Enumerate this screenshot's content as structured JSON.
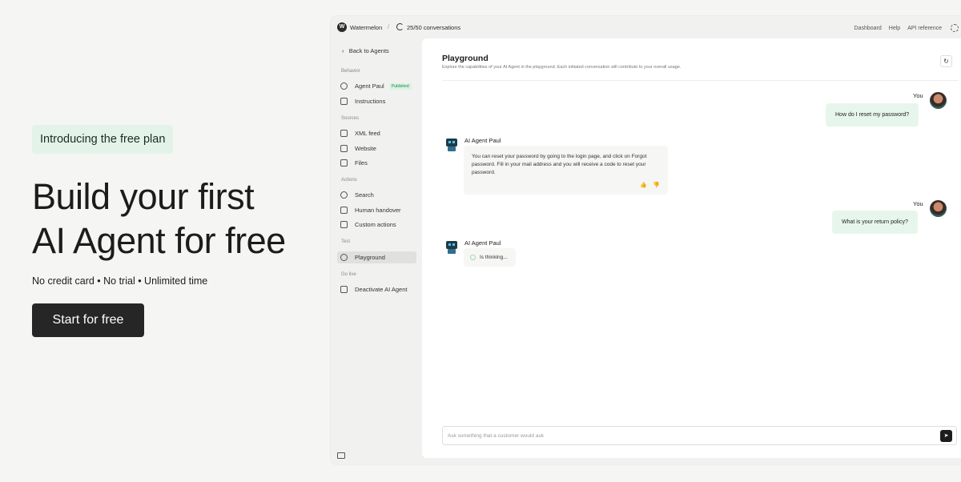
{
  "hero": {
    "badge": "Introducing the free plan",
    "title_line1": "Build your first",
    "title_line2": "AI Agent for free",
    "subtitle": "No credit card • No trial • Unlimited time",
    "cta": "Start for free"
  },
  "app": {
    "logo_letter": "W",
    "brand": "Watermelon",
    "separator": "/",
    "conversations": "25/50 conversations",
    "top_links": [
      "Dashboard",
      "Help",
      "API reference"
    ],
    "sidebar": {
      "back": "Back to Agents",
      "sections": {
        "behavior": "Behavior",
        "sources": "Sources",
        "actions": "Actions",
        "test": "Test",
        "golive": "Go live"
      },
      "items": {
        "agent": "Agent Paul",
        "published": "Published",
        "instructions": "Instructions",
        "xml": "XML feed",
        "website": "Website",
        "files": "Files",
        "search": "Search",
        "handover": "Human handover",
        "custom": "Custom actions",
        "playground": "Playground",
        "deactivate": "Deactivate AI Agent"
      }
    },
    "playground": {
      "title": "Playground",
      "description": "Explore the capabilities of your AI Agent in the playground. Each initiated conversation will contribute to your overall usage.",
      "refresh_icon": "↻",
      "messages": {
        "user_label": "You",
        "agent_label": "AI Agent Paul",
        "q1": "How do I reset my password?",
        "a1": "You can reset your password by going to the login page, and click on Forgot password. Fill in your mail address and you will receive a code to reset your password.",
        "thumbs_up": "👍",
        "thumbs_down": "👎",
        "q2": "What is your return policy?",
        "thinking": "Is thinking..."
      },
      "composer_placeholder": "Ask something that a customer would ask",
      "send_icon": "➤"
    }
  }
}
